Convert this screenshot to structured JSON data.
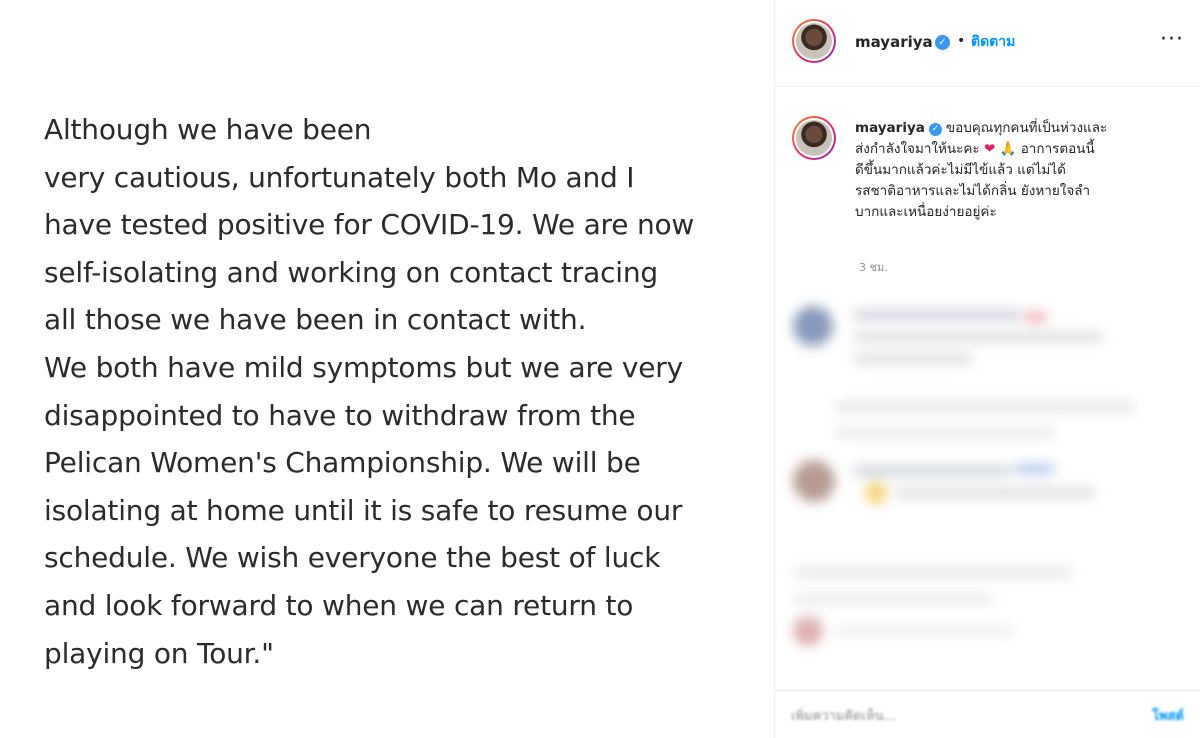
{
  "post": {
    "statement_lines": [
      "Although we have been",
      "very cautious, unfortunately both Mo and I",
      "have tested positive for COVID-19. We are now",
      "self-isolating and working on contact tracing",
      "all those we have been in contact with.",
      "We both have mild symptoms but we are very",
      "disappointed to have to withdraw from the",
      "Pelican Women's Championship. We will be",
      "isolating at home until it is safe to resume our",
      "schedule. We wish everyone the best of luck",
      "and look forward to when we can return to",
      "playing on Tour.\""
    ]
  },
  "header": {
    "username": "mayariya",
    "verified_icon": "verified-badge-icon",
    "dot": "•",
    "follow_label": "ติดตาม",
    "more_icon": "more-options-icon",
    "more_glyph": "···"
  },
  "caption": {
    "username": "mayariya",
    "line1": "ขอบคุณทุกคนที่เป็นห่วงและ",
    "line2a": "ส่งกำลังใจมาให้นะคะ",
    "heart": "❤",
    "pray": "🙏",
    "line2b": "อาการตอนนี้",
    "line3": "ดีขึ้นมากแล้วค่ะไม่มีไข้แล้ว แต่ไม่ได้",
    "line4": "รสชาติอาหารและไม่ได้กลิ่น ยังหายใจลำ",
    "line5": "บากและเหนื่อยง่ายอยู่ค่ะ",
    "time": "3 ชม."
  },
  "footer": {
    "comment_placeholder": "เพิ่มความคิดเห็น...",
    "post_label": "โพสต์"
  },
  "colors": {
    "accent": "#0095f6",
    "verified": "#3897f0",
    "text": "#262626",
    "muted": "#8e8e8e"
  }
}
